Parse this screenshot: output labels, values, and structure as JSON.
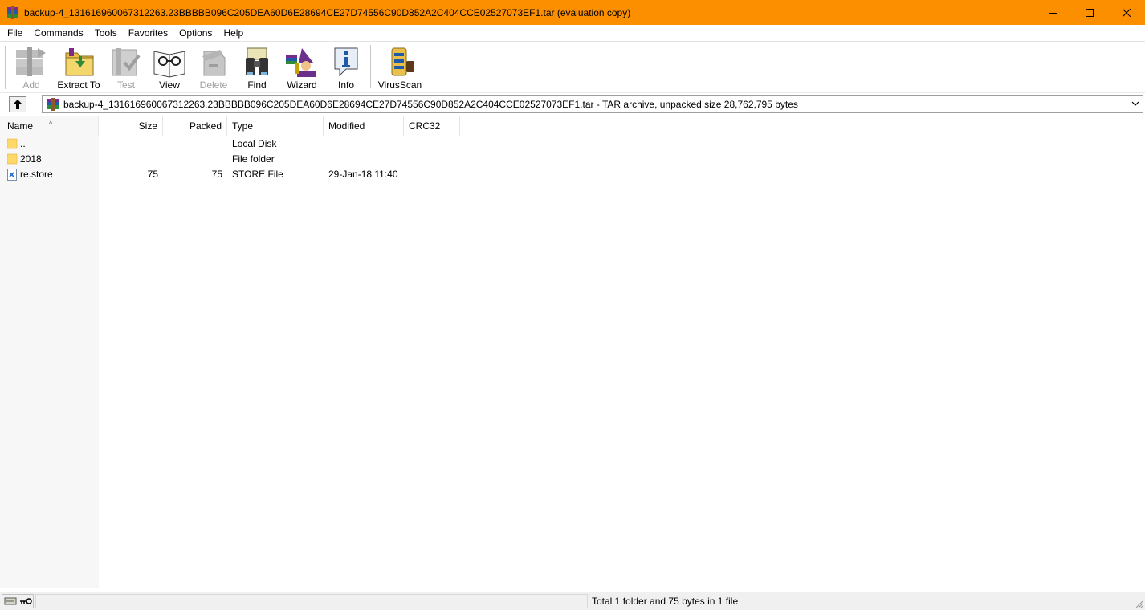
{
  "window": {
    "title": "backup-4_131616960067312263.23BBBBB096C205DEA60D6E28694CE27D74556C90D852A2C404CCE02527073EF1.tar (evaluation copy)",
    "app_icon": "winrar-books-icon",
    "titlebar_color": "#fb8f00",
    "controls": [
      "minimize-icon",
      "maximize-icon",
      "close-icon"
    ]
  },
  "menu": {
    "items": [
      "File",
      "Commands",
      "Tools",
      "Favorites",
      "Options",
      "Help"
    ]
  },
  "toolbar": {
    "buttons": [
      {
        "label": "Add",
        "icon": "add-icon",
        "enabled": false
      },
      {
        "label": "Extract To",
        "icon": "extract-to-icon",
        "enabled": true
      },
      {
        "label": "Test",
        "icon": "test-icon",
        "enabled": false
      },
      {
        "label": "View",
        "icon": "view-icon",
        "enabled": true
      },
      {
        "label": "Delete",
        "icon": "delete-icon",
        "enabled": false
      },
      {
        "label": "Find",
        "icon": "find-icon",
        "enabled": true
      },
      {
        "label": "Wizard",
        "icon": "wizard-icon",
        "enabled": true
      },
      {
        "label": "Info",
        "icon": "info-icon",
        "enabled": true
      },
      {
        "label": "VirusScan",
        "icon": "virusscan-icon",
        "enabled": true
      }
    ]
  },
  "address": {
    "path": "backup-4_131616960067312263.23BBBBB096C205DEA60D6E28694CE27D74556C90D852A2C404CCE02527073EF1.tar - TAR archive, unpacked size 28,762,795 bytes"
  },
  "list": {
    "columns": [
      "Name",
      "Size",
      "Packed",
      "Type",
      "Modified",
      "CRC32"
    ],
    "sorted_by": "Name",
    "rows": [
      {
        "name": "..",
        "size": "",
        "packed": "",
        "type": "Local Disk",
        "modified": "",
        "crc32": "",
        "icon": "folder-icon"
      },
      {
        "name": "2018",
        "size": "",
        "packed": "",
        "type": "File folder",
        "modified": "",
        "crc32": "",
        "icon": "folder-icon"
      },
      {
        "name": "re.store",
        "size": "75",
        "packed": "75",
        "type": "STORE File",
        "modified": "29-Jan-18 11:40",
        "crc32": "",
        "icon": "store-file-icon"
      }
    ]
  },
  "status": {
    "text": "Total 1 folder and 75 bytes in 1 file"
  }
}
